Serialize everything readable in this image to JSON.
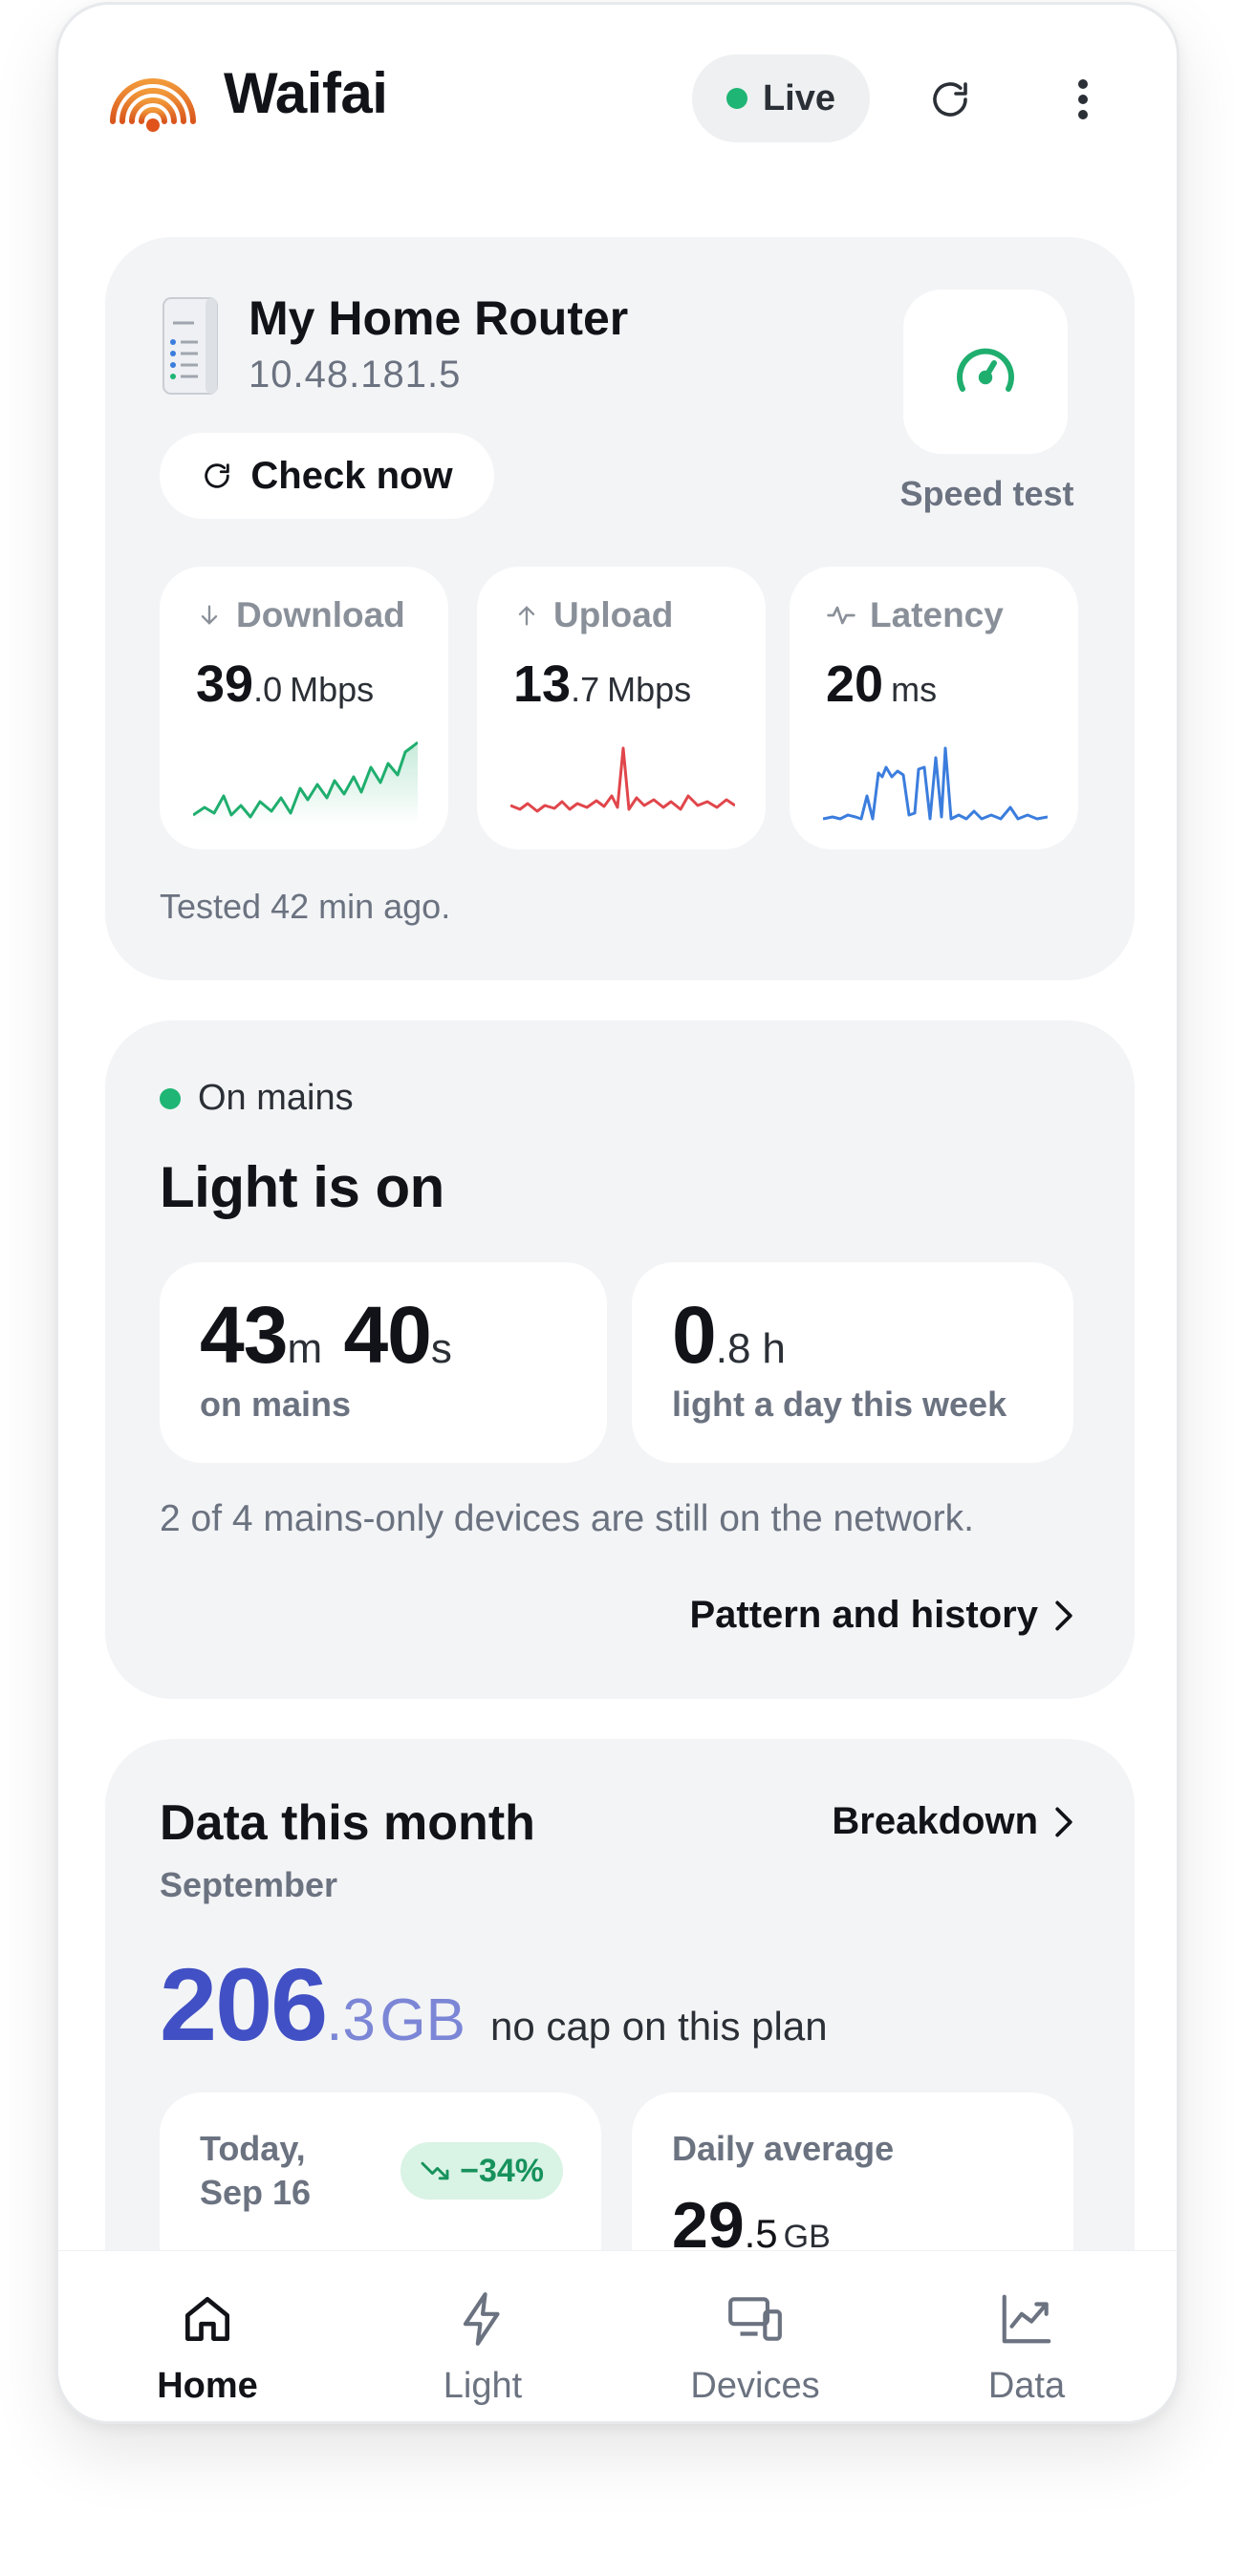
{
  "app": {
    "title": "Waifai",
    "live_label": "Live"
  },
  "icons": {
    "logo": "wifi-signal-logo",
    "refresh": "refresh-icon",
    "more": "more-vertical-icon"
  },
  "router": {
    "name": "My Home Router",
    "ip": "10.48.181.5",
    "check_label": "Check now",
    "speed_test_label": "Speed test",
    "tested_text": "Tested 42 min ago.",
    "metrics": [
      {
        "label": "Download",
        "int": "39",
        "dec": ".0",
        "unit": "Mbps",
        "color": "#1fae6e"
      },
      {
        "label": "Upload",
        "int": "13",
        "dec": ".7",
        "unit": "Mbps",
        "color": "#e0464b"
      },
      {
        "label": "Latency",
        "int": "20",
        "dec": "",
        "unit": "ms",
        "color": "#3b7ddd"
      }
    ]
  },
  "light": {
    "status": "On mains",
    "title": "Light is on",
    "duration": {
      "min": "43",
      "min_unit": "m",
      "sec": "40",
      "sec_unit": "s",
      "label": "on mains"
    },
    "daily": {
      "int": "0",
      "dec": ".8",
      "unit": "h",
      "label": "light a day this week"
    },
    "note": "2 of 4 mains-only devices are still on the network.",
    "link": "Pattern and history"
  },
  "data_month": {
    "title": "Data this month",
    "link": "Breakdown",
    "month": "September",
    "total_int": "206",
    "total_dec": ".3",
    "total_unit": "GB",
    "cap_note": "no cap on this plan",
    "today_label_1": "Today,",
    "today_label_2": "Sep 16",
    "today_change": "−34%",
    "avg_label": "Daily average",
    "avg_int": "29",
    "avg_dec": ".5",
    "avg_unit": "GB"
  },
  "nav": [
    {
      "label": "Home",
      "icon": "home-icon",
      "active": true
    },
    {
      "label": "Light",
      "icon": "lightning-icon",
      "active": false
    },
    {
      "label": "Devices",
      "icon": "devices-icon",
      "active": false
    },
    {
      "label": "Data",
      "icon": "trend-chart-icon",
      "active": false
    }
  ],
  "colors": {
    "accent_green": "#1fb574",
    "data_blue": "#4150c4",
    "card_bg": "#f3f4f6"
  }
}
